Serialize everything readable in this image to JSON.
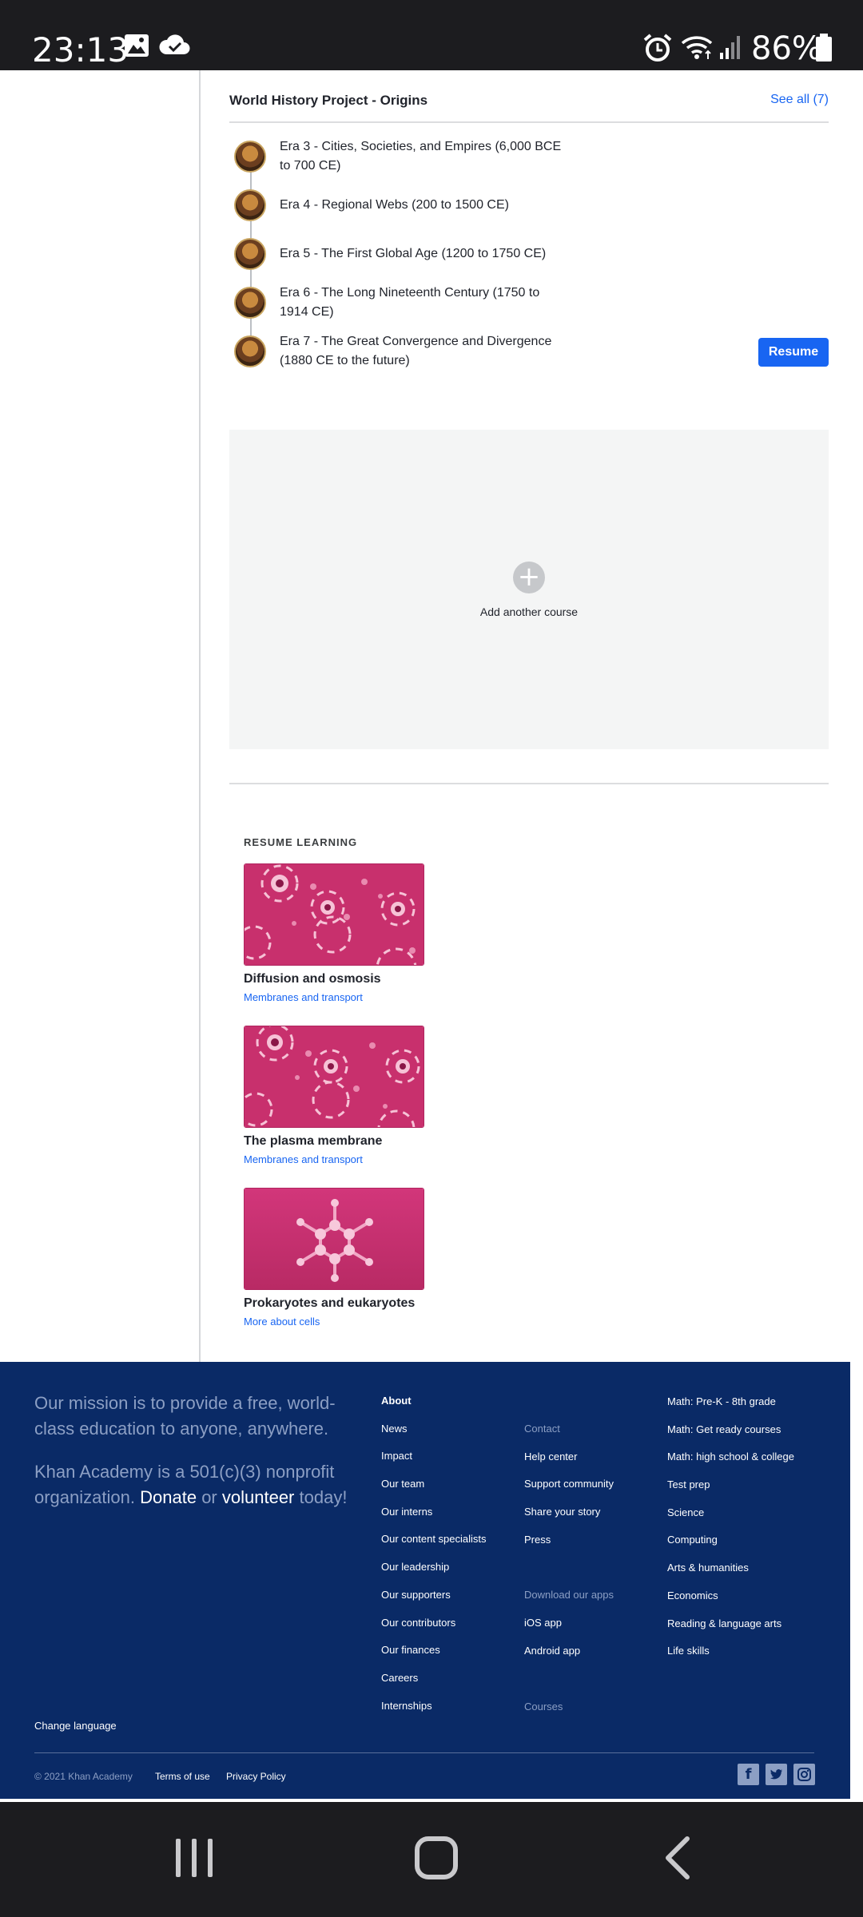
{
  "status_bar": {
    "time": "23:13",
    "battery": "86%"
  },
  "course": {
    "title": "World History Project - Origins",
    "see_all": "See all (7)",
    "eras": [
      {
        "label": "Era 3 - Cities, Societies, and Empires (6,000 BCE to 700 CE)"
      },
      {
        "label": "Era 4 - Regional Webs (200 to 1500 CE)"
      },
      {
        "label": "Era 5 - The First Global Age (1200 to 1750 CE)"
      },
      {
        "label": "Era 6 - The Long Nineteenth Century (1750 to 1914 CE)"
      },
      {
        "label": "Era 7 - The Great Convergence and Divergence (1880 CE to the future)"
      }
    ],
    "resume_label": "Resume"
  },
  "add_course": {
    "label": "Add another course"
  },
  "resume_learning": {
    "heading": "RESUME LEARNING",
    "cards": [
      {
        "title": "Diffusion and osmosis",
        "subtitle": "Membranes and transport"
      },
      {
        "title": "The plasma membrane",
        "subtitle": "Membranes and transport"
      },
      {
        "title": "Prokaryotes and eukaryotes",
        "subtitle": "More about cells"
      }
    ]
  },
  "footer": {
    "mission": "Our mission is to provide a free, world-class education to anyone, anywhere.",
    "nonprofit_pre": "Khan Academy is a 501(c)(3) nonprofit organization.",
    "donate": "Donate",
    "or": "or",
    "volunteer": "volunteer",
    "today": "today!",
    "about": {
      "heading": "About",
      "items": [
        "News",
        "Impact",
        "Our team",
        "Our interns",
        "Our content specialists",
        "Our leadership",
        "Our supporters",
        "Our contributors",
        "Our finances",
        "Careers",
        "Internships"
      ]
    },
    "contact": {
      "heading": "Contact",
      "items": [
        "Help center",
        "Support community",
        "Share your story",
        "Press"
      ]
    },
    "apps": {
      "heading": "Download our apps",
      "items": [
        "iOS app",
        "Android app"
      ]
    },
    "courses_heading": "Courses",
    "subjects": [
      "Math: Pre-K - 8th grade",
      "Math: Get ready courses",
      "Math: high school & college",
      "Test prep",
      "Science",
      "Computing",
      "Arts & humanities",
      "Economics",
      "Reading & language arts",
      "Life skills"
    ],
    "change_language": "Change language",
    "copyright": "© 2021 Khan Academy",
    "terms": "Terms of use",
    "privacy": "Privacy Policy"
  }
}
